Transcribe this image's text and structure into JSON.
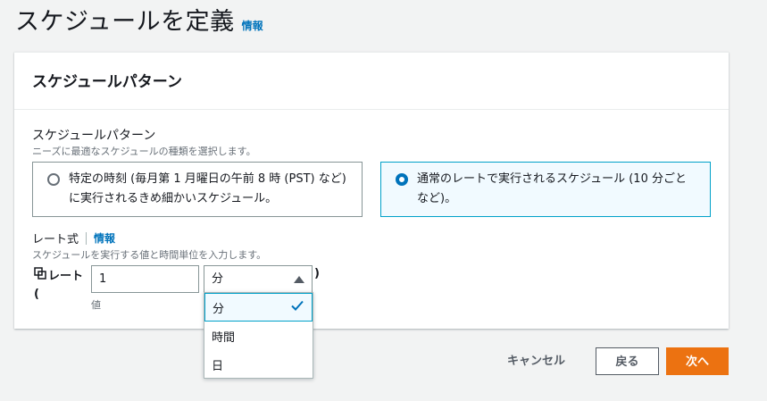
{
  "page": {
    "title": "スケジュールを定義",
    "info_link": "情報"
  },
  "panel": {
    "title": "スケジュールパターン",
    "pattern_label": "スケジュールパターン",
    "pattern_description": "ニーズに最適なスケジュールの種類を選択します。",
    "options": [
      {
        "label": "特定の時刻 (毎月第 1 月曜日の午前 8 時 (PST) など) に実行されるきめ細かいスケジュール。",
        "selected": false
      },
      {
        "label": "通常のレートで実行されるスケジュール (10 分ごとなど)。",
        "selected": true
      }
    ],
    "rate": {
      "label": "レート式",
      "info_link": "情報",
      "description": "スケジュールを実行する値と時間単位を入力します。",
      "prefix": "レート (",
      "value": "1",
      "value_label": "値",
      "unit_selected": "分",
      "close_paren": ")"
    }
  },
  "dropdown": {
    "options": [
      {
        "label": "分",
        "selected": true
      },
      {
        "label": "時間",
        "selected": false
      },
      {
        "label": "日",
        "selected": false
      }
    ]
  },
  "footer": {
    "cancel": "キャンセル",
    "back": "戻る",
    "next": "次へ"
  },
  "colors": {
    "accent": "#0073bb",
    "primary_button": "#ec7211",
    "selected_border": "#00a1c9",
    "selected_bg": "#f1faff"
  },
  "icons": {
    "copy": "copy-icon",
    "check": "check-icon",
    "caret": "caret-up-icon"
  }
}
